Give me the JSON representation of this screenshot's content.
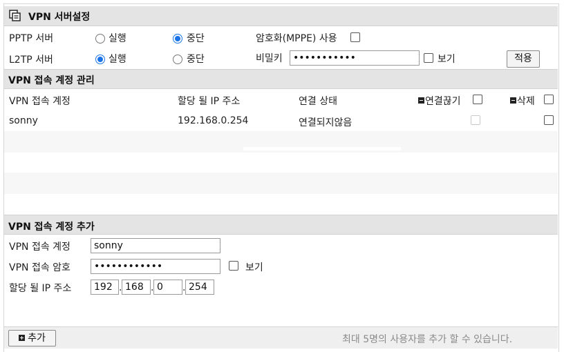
{
  "header": {
    "title": "VPN 서버설정",
    "icon": "window-copy-icon"
  },
  "server": {
    "pptp_label": "PPTP 서버",
    "l2tp_label": "L2TP 서버",
    "run_label": "실행",
    "stop_label": "중단",
    "pptp_selected": "중단",
    "l2tp_selected": "실행",
    "mppe_label": "암호화(MPPE) 사용",
    "mppe_checked": false,
    "secret_label": "비밀키",
    "secret_value": "•••••••••••",
    "show_label": "보기",
    "apply_label": "적용"
  },
  "accounts": {
    "section_title": "VPN 접속 계정 관리",
    "columns": {
      "account": "VPN 접속 계정",
      "ip": "할당 될 IP 주소",
      "status": "연결 상태",
      "disconnect": "연결끊기",
      "delete": "삭제"
    },
    "rows": [
      {
        "account": "sonny",
        "ip": "192.168.0.254",
        "status": "연결되지않음"
      }
    ]
  },
  "add": {
    "section_title": "VPN 접속 계정 추가",
    "account_label": "VPN 접속 계정",
    "account_value": "sonny",
    "password_label": "VPN 접속 암호",
    "password_value": "••••••••••••",
    "show_label": "보기",
    "ip_label": "할당 될 IP 주소",
    "ip_octets": [
      "192",
      "168",
      "0",
      "254"
    ]
  },
  "footer": {
    "add_button": "추가",
    "hint": "최대 5명의 사용자를 추가 할 수 있습니다."
  },
  "colors": {
    "accent": "#1a73e8",
    "header_bg": "#e4e4e4",
    "hint_text": "#8a8a8a"
  }
}
